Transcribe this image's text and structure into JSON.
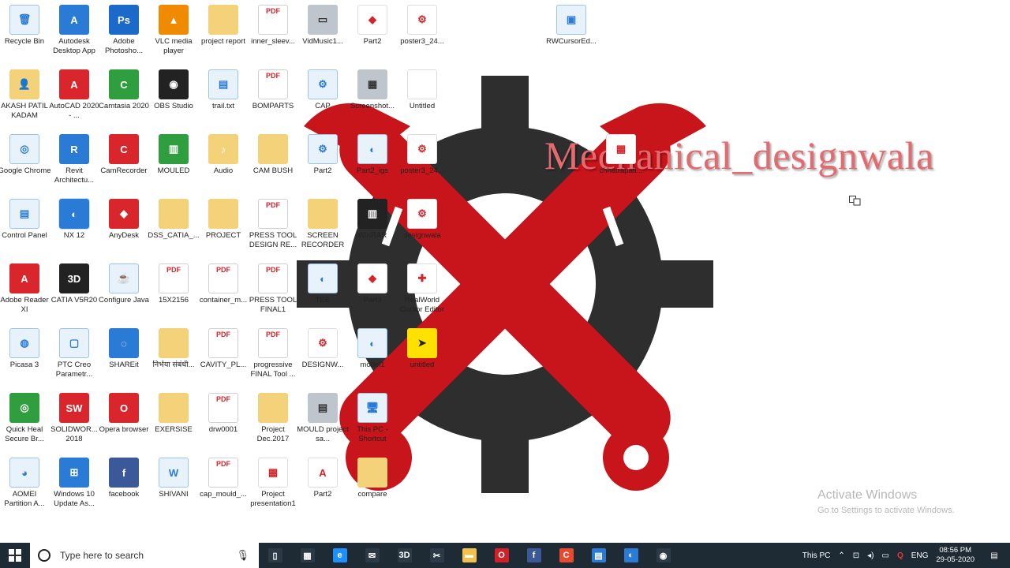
{
  "wallpaper": {
    "brand_text": "Mechanical_designwala",
    "gear_color": "#2e2e2e",
    "wrench_color": "#c8141b"
  },
  "activation": {
    "title": "Activate Windows",
    "subtitle": "Go to Settings to activate Windows."
  },
  "desktop_icons": [
    {
      "label": "Recycle Bin",
      "icon": "recycle-bin-icon",
      "glyph": "🗑"
    },
    {
      "label": "Autodesk Desktop App",
      "icon": "autodesk-icon",
      "glyph": "A"
    },
    {
      "label": "Adobe Photosho...",
      "icon": "photoshop-icon",
      "glyph": "Ps"
    },
    {
      "label": "VLC media player",
      "icon": "vlc-icon",
      "glyph": "▲"
    },
    {
      "label": "project report",
      "icon": "folder-icon",
      "glyph": ""
    },
    {
      "label": "inner_sleev...",
      "icon": "pdf-icon",
      "glyph": "PDF"
    },
    {
      "label": "VidMusic1...",
      "icon": "video-file-icon",
      "glyph": "▭"
    },
    {
      "label": "Part2",
      "icon": "part-file-icon",
      "glyph": "◆"
    },
    {
      "label": "poster3_24...",
      "icon": "image-file-icon",
      "glyph": "⚙"
    },
    {
      "label": "RWCursorEd...",
      "icon": "installer-icon",
      "glyph": "▣"
    },
    {
      "label": "AKASH PATIL KADAM",
      "icon": "user-folder-icon",
      "glyph": "👤"
    },
    {
      "label": "AutoCAD 2020 - ...",
      "icon": "autocad-icon",
      "glyph": "A"
    },
    {
      "label": "Camtasia 2020",
      "icon": "camtasia-icon",
      "glyph": "C"
    },
    {
      "label": "OBS Studio",
      "icon": "obs-icon",
      "glyph": "◉"
    },
    {
      "label": "trail.txt",
      "icon": "text-file-icon",
      "glyph": "▤"
    },
    {
      "label": "BOMPARTS",
      "icon": "pdf-icon",
      "glyph": "PDF"
    },
    {
      "label": "CAP",
      "icon": "catia-part-icon",
      "glyph": "⚙"
    },
    {
      "label": "Screenshot...",
      "icon": "screenshot-icon",
      "glyph": "▦"
    },
    {
      "label": "Untitled",
      "icon": "blank-file-icon",
      "glyph": ""
    },
    {
      "label": "Google Chrome",
      "icon": "chrome-icon",
      "glyph": "◎"
    },
    {
      "label": "Revit Architectu...",
      "icon": "revit-icon",
      "glyph": "R"
    },
    {
      "label": "CamRecorder",
      "icon": "camrecorder-icon",
      "glyph": "C"
    },
    {
      "label": "MOULED",
      "icon": "archive-icon",
      "glyph": "▥"
    },
    {
      "label": "Audio",
      "icon": "audio-folder-icon",
      "glyph": "♪"
    },
    {
      "label": "CAM BUSH",
      "icon": "folder-icon",
      "glyph": ""
    },
    {
      "label": "Part2",
      "icon": "catia-part-icon",
      "glyph": "⚙"
    },
    {
      "label": "Part2_igs",
      "icon": "nx-file-icon",
      "glyph": "◐"
    },
    {
      "label": "poster3_24...",
      "icon": "image-file-icon",
      "glyph": "⚙"
    },
    {
      "label": "chhatrapati...",
      "icon": "image-file-icon",
      "glyph": "▦"
    },
    {
      "label": "Control Panel",
      "icon": "control-panel-icon",
      "glyph": "▤"
    },
    {
      "label": "NX 12",
      "icon": "nx-icon",
      "glyph": "◐"
    },
    {
      "label": "AnyDesk",
      "icon": "anydesk-icon",
      "glyph": "◆"
    },
    {
      "label": "DSS_CATIA_...",
      "icon": "folder-icon",
      "glyph": ""
    },
    {
      "label": "PROJECT",
      "icon": "folder-icon",
      "glyph": ""
    },
    {
      "label": "PRESS TOOL DESIGN RE...",
      "icon": "pdf-icon",
      "glyph": "PDF"
    },
    {
      "label": "SCREEN RECORDER",
      "icon": "folder-icon",
      "glyph": ""
    },
    {
      "label": "WinRAR",
      "icon": "winrar-icon",
      "glyph": "▥"
    },
    {
      "label": "designwala",
      "icon": "image-file-icon",
      "glyph": "⚙"
    },
    {
      "label": "Adobe Reader XI",
      "icon": "acrobat-icon",
      "glyph": "A"
    },
    {
      "label": "CATIA V5R20",
      "icon": "catia-icon",
      "glyph": "3D"
    },
    {
      "label": "Configure Java",
      "icon": "java-icon",
      "glyph": "☕"
    },
    {
      "label": "15X2156",
      "icon": "pdf-icon",
      "glyph": "PDF"
    },
    {
      "label": "container_m...",
      "icon": "pdf-icon",
      "glyph": "PDF"
    },
    {
      "label": "PRESS TOOL FINAL1",
      "icon": "pdf-icon",
      "glyph": "PDF"
    },
    {
      "label": "TEE",
      "icon": "nx-file-icon",
      "glyph": "◐"
    },
    {
      "label": "Part3",
      "icon": "part-file-icon",
      "glyph": "◆"
    },
    {
      "label": "RealWorld Cursor Editor",
      "icon": "cursor-editor-icon",
      "glyph": "✚"
    },
    {
      "label": "Picasa 3",
      "icon": "picasa-icon",
      "glyph": "◍"
    },
    {
      "label": "PTC Creo Parametr...",
      "icon": "creo-icon",
      "glyph": "▢"
    },
    {
      "label": "SHAREit",
      "icon": "shareit-icon",
      "glyph": "◌"
    },
    {
      "label": "निर्भया संबंधी...",
      "icon": "folder-icon",
      "glyph": ""
    },
    {
      "label": "CAVITY_PL...",
      "icon": "pdf-icon",
      "glyph": "PDF"
    },
    {
      "label": "progressive FINAL Tool ...",
      "icon": "pdf-icon",
      "glyph": "PDF"
    },
    {
      "label": "DESIGNW...",
      "icon": "image-file-icon",
      "glyph": "⚙"
    },
    {
      "label": "model1",
      "icon": "nx-file-icon",
      "glyph": "◐"
    },
    {
      "label": "untitled",
      "icon": "cursor-file-icon",
      "glyph": "➤"
    },
    {
      "label": "Quick Heal Secure Br...",
      "icon": "quickheal-icon",
      "glyph": "◎"
    },
    {
      "label": "SOLIDWOR... 2018",
      "icon": "solidworks-icon",
      "glyph": "SW"
    },
    {
      "label": "Opera browser",
      "icon": "opera-icon",
      "glyph": "O"
    },
    {
      "label": "EXERSISE",
      "icon": "folder-icon",
      "glyph": ""
    },
    {
      "label": "drw0001",
      "icon": "pdf-icon",
      "glyph": "PDF"
    },
    {
      "label": "Project Dec.2017",
      "icon": "folder-icon",
      "glyph": ""
    },
    {
      "label": "MOULD project sa...",
      "icon": "document-icon",
      "glyph": "▤"
    },
    {
      "label": "This PC - Shortcut",
      "icon": "this-pc-icon",
      "glyph": "🖥"
    },
    {
      "label": "AOMEI Partition A...",
      "icon": "aomei-icon",
      "glyph": "◕"
    },
    {
      "label": "Windows 10 Update As...",
      "icon": "windows-update-icon",
      "glyph": "⊞"
    },
    {
      "label": "facebook",
      "icon": "facebook-icon",
      "glyph": "f"
    },
    {
      "label": "SHIVANI",
      "icon": "word-doc-icon",
      "glyph": "W"
    },
    {
      "label": "cap_mould_...",
      "icon": "pdf-icon",
      "glyph": "PDF"
    },
    {
      "label": "Project presentation1",
      "icon": "powerpoint-icon",
      "glyph": "▦"
    },
    {
      "label": "Part2",
      "icon": "autocad-file-icon",
      "glyph": "A"
    },
    {
      "label": "compare",
      "icon": "folder-icon",
      "glyph": ""
    }
  ],
  "taskbar": {
    "search_placeholder": "Type here to search",
    "pinned": [
      {
        "icon": "task-view-icon",
        "glyph": "▯"
      },
      {
        "icon": "store-icon",
        "glyph": "▦"
      },
      {
        "icon": "edge-icon",
        "glyph": "e"
      },
      {
        "icon": "mail-icon",
        "glyph": "✉"
      },
      {
        "icon": "catia-taskbar-icon",
        "glyph": "3D"
      },
      {
        "icon": "snip-icon",
        "glyph": "✂"
      },
      {
        "icon": "file-explorer-icon",
        "glyph": "▬"
      },
      {
        "icon": "opera-taskbar-icon",
        "glyph": "O"
      },
      {
        "icon": "facebook-taskbar-icon",
        "glyph": "f"
      },
      {
        "icon": "camrecorder-taskbar-icon",
        "glyph": "C"
      },
      {
        "icon": "document-taskbar-icon",
        "glyph": "▤"
      },
      {
        "icon": "nx-taskbar-icon",
        "glyph": "◐"
      },
      {
        "icon": "obs-taskbar-icon",
        "glyph": "◉"
      }
    ],
    "tray_label": "This PC",
    "language": "ENG",
    "time": "08:56 PM",
    "date": "29-05-2020"
  }
}
